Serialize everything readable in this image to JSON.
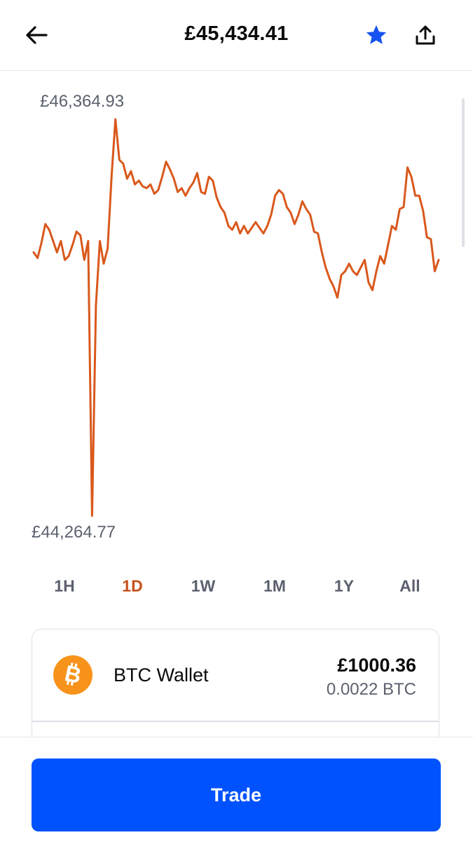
{
  "header": {
    "title": "£45,434.41",
    "back_icon": "arrow-left-icon",
    "star_icon": "star-icon",
    "share_icon": "share-icon",
    "star_color": "#1652f0"
  },
  "chart": {
    "high_label": "£46,364.93",
    "low_label": "£44,264.77",
    "line_color": "#d9581c"
  },
  "chart_data": {
    "type": "line",
    "ylim": [
      44264.77,
      46364.93
    ],
    "y": [
      45660,
      45630,
      45710,
      45810,
      45780,
      45720,
      45660,
      45720,
      45620,
      45640,
      45700,
      45770,
      45750,
      45620,
      45720,
      44264.77,
      45380,
      45720,
      45600,
      45680,
      46060,
      46364.93,
      46150,
      46130,
      46050,
      46090,
      46020,
      46040,
      46010,
      46000,
      46020,
      45970,
      45990,
      46060,
      46140,
      46100,
      46050,
      45980,
      46000,
      45960,
      46000,
      46030,
      46080,
      45980,
      45970,
      46060,
      46040,
      45950,
      45900,
      45870,
      45800,
      45780,
      45820,
      45760,
      45800,
      45760,
      45790,
      45820,
      45790,
      45760,
      45800,
      45860,
      45960,
      45990,
      45970,
      45900,
      45870,
      45810,
      45860,
      45930,
      45890,
      45860,
      45770,
      45760,
      45660,
      45580,
      45520,
      45480,
      45420,
      45540,
      45560,
      45600,
      45560,
      45540,
      45580,
      45620,
      45500,
      45460,
      45560,
      45640,
      45600,
      45700,
      45800,
      45780,
      45890,
      45900,
      46110,
      46060,
      45960,
      45960,
      45880,
      45740,
      45730,
      45560,
      45620
    ]
  },
  "tabs": [
    {
      "label": "1H"
    },
    {
      "label": "1D"
    },
    {
      "label": "1W"
    },
    {
      "label": "1M"
    },
    {
      "label": "1Y"
    },
    {
      "label": "All"
    }
  ],
  "active_tab": "1D",
  "wallet": {
    "label": "BTC Wallet",
    "fiat_value": "£1000.36",
    "crypto_value": "0.0022 BTC",
    "logo_icon": "bitcoin-icon",
    "logo_color": "#f7931a"
  },
  "trade_button": {
    "label": "Trade",
    "color": "#0052ff"
  }
}
